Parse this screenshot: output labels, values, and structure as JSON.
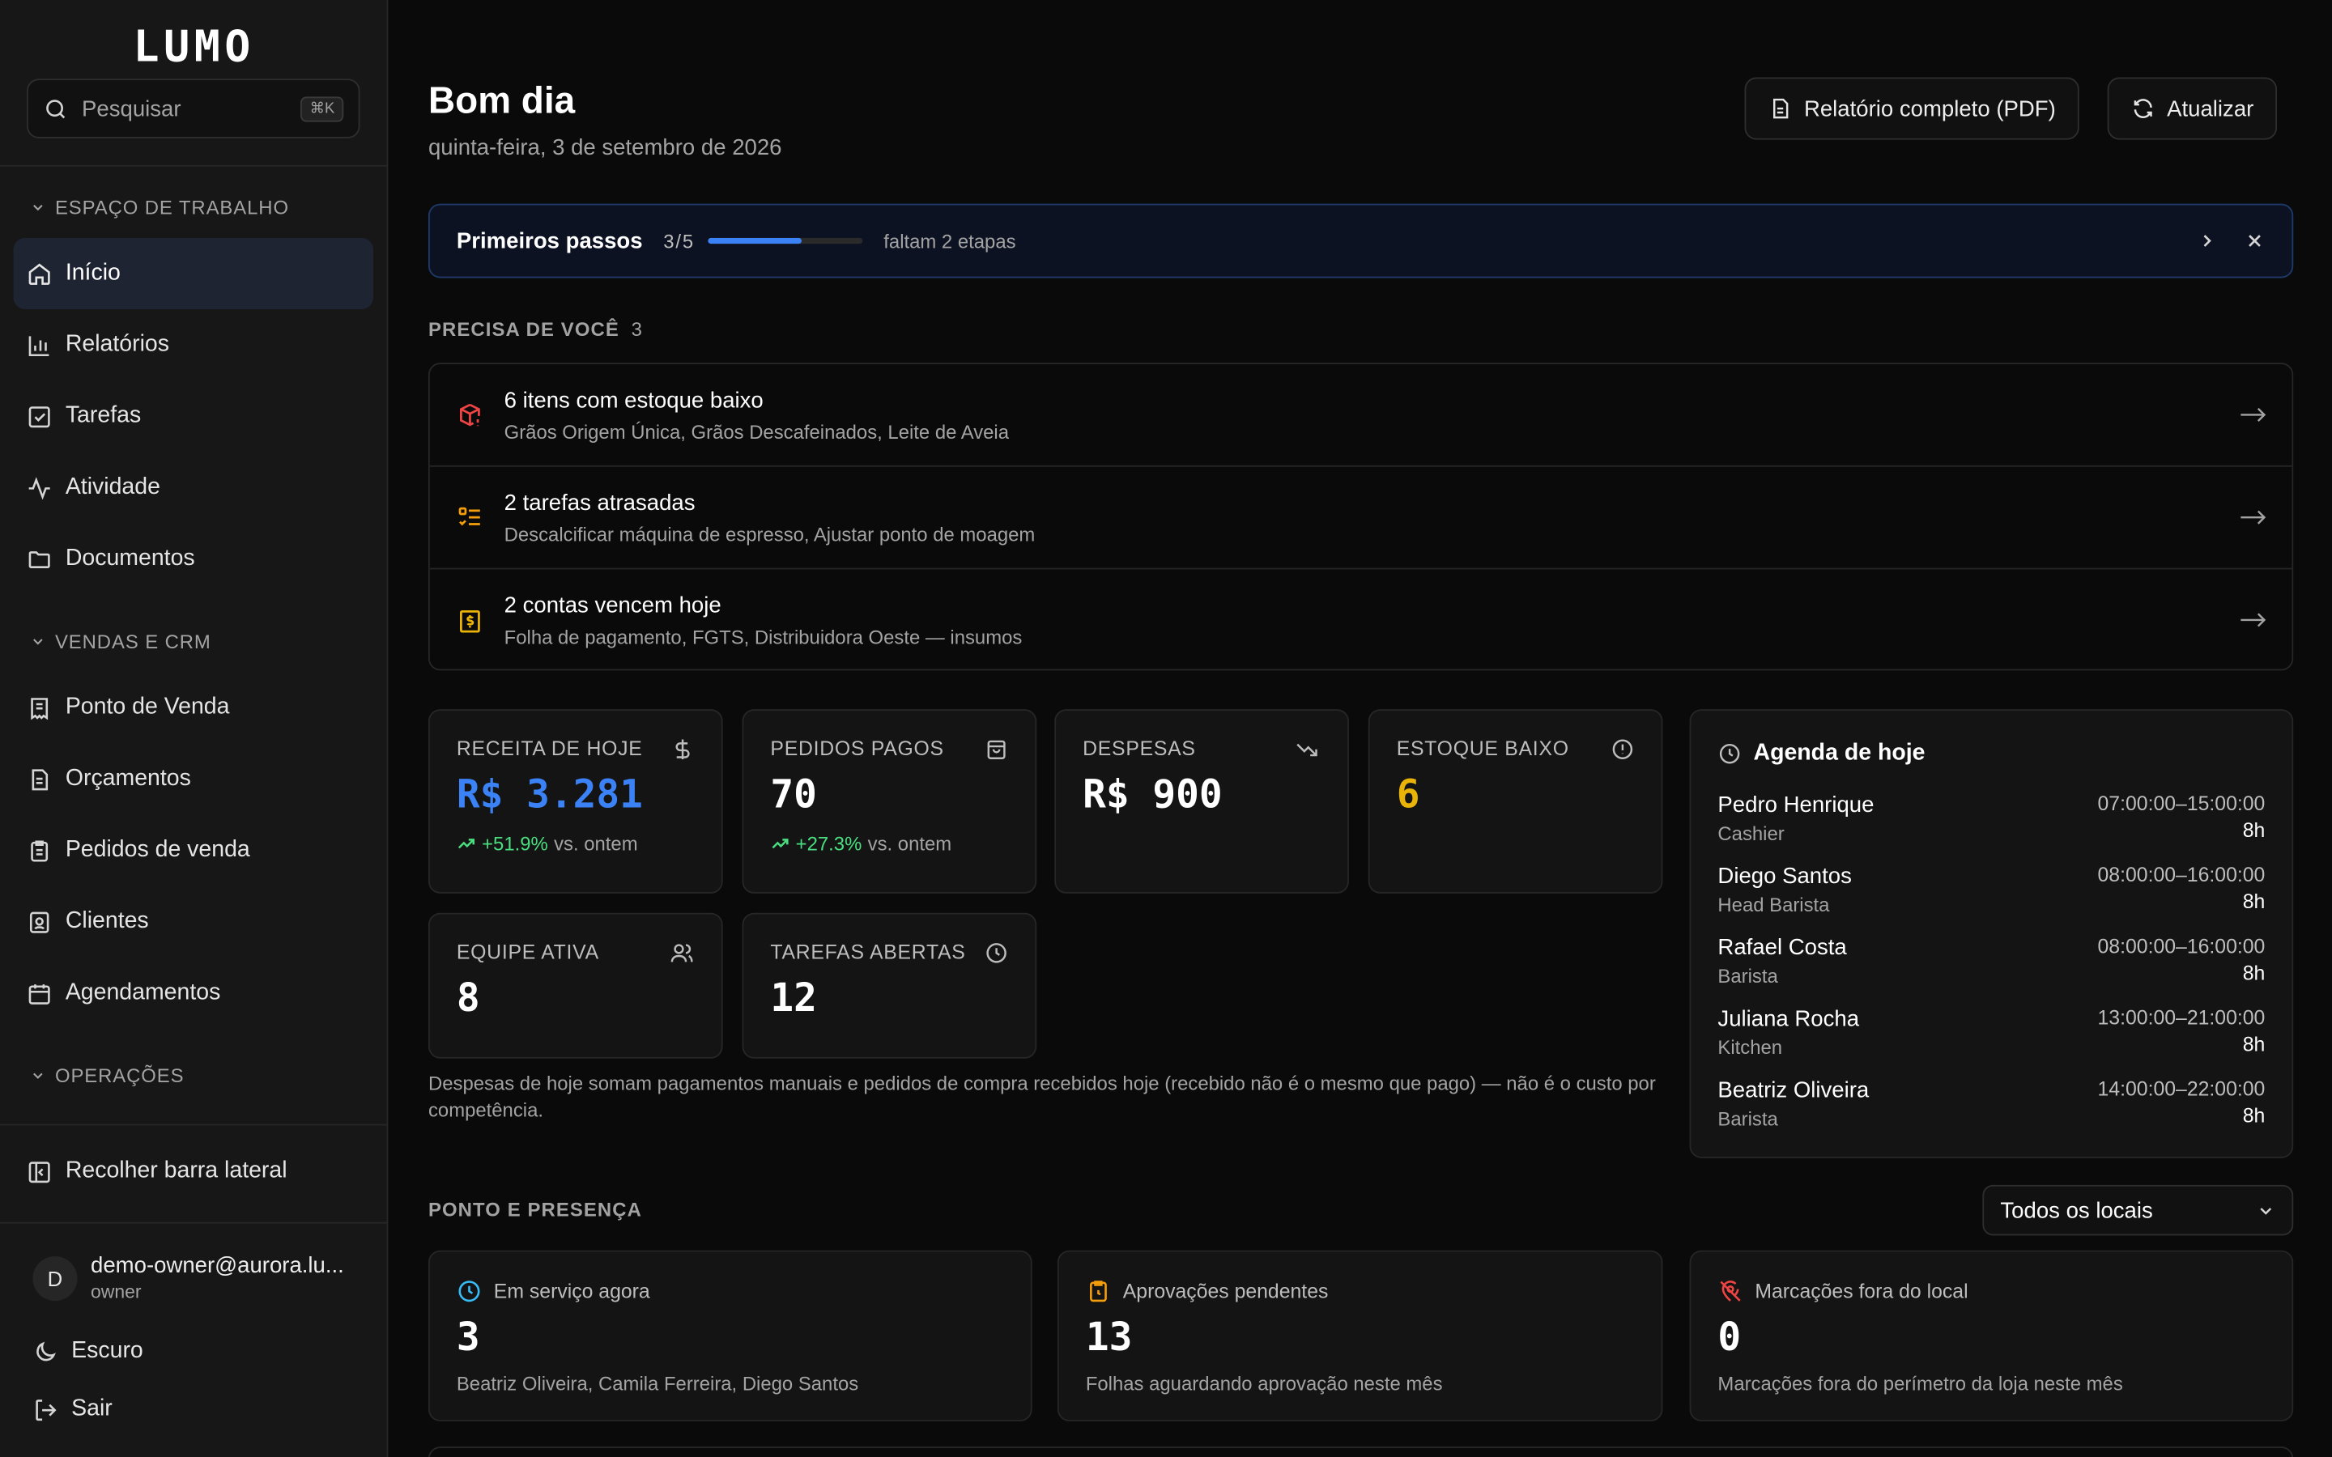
{
  "brand": {
    "logo": "LUMO"
  },
  "search": {
    "placeholder": "Pesquisar",
    "shortcut": "⌘K"
  },
  "sidebar": {
    "workspace_title": "ESPAÇO DE TRABALHO",
    "workspace": [
      {
        "label": "Início",
        "icon": "home-icon",
        "active": true
      },
      {
        "label": "Relatórios",
        "icon": "bar-chart-icon"
      },
      {
        "label": "Tarefas",
        "icon": "checkbox-icon"
      },
      {
        "label": "Atividade",
        "icon": "activity-icon"
      },
      {
        "label": "Documentos",
        "icon": "folder-icon"
      }
    ],
    "sales_title": "VENDAS E CRM",
    "sales": [
      {
        "label": "Ponto de Venda",
        "icon": "receipt-icon"
      },
      {
        "label": "Orçamentos",
        "icon": "document-icon"
      },
      {
        "label": "Pedidos de venda",
        "icon": "clipboard-icon"
      },
      {
        "label": "Clientes",
        "icon": "contact-icon"
      },
      {
        "label": "Agendamentos",
        "icon": "calendar-icon"
      }
    ],
    "ops_title": "OPERAÇÕES",
    "collapse": "Recolher barra lateral",
    "user": {
      "initial": "D",
      "email": "demo-owner@aurora.lu...",
      "role": "owner"
    },
    "theme": "Escuro",
    "logout": "Sair"
  },
  "header": {
    "greeting": "Bom dia",
    "date": "quinta-feira, 3 de setembro de 2026",
    "report_button": "Relatório completo (PDF)",
    "refresh_button": "Atualizar"
  },
  "onboarding": {
    "title": "Primeiros passos",
    "count": "3/5",
    "progress": 0.6,
    "remaining": "faltam 2 etapas"
  },
  "needs_you": {
    "title": "PRECISA DE VOCÊ",
    "count": "3",
    "items": [
      {
        "title": "6 itens com estoque baixo",
        "subtitle": "Grãos Origem Única, Grãos Descafeinados, Leite de Aveia",
        "icon": "package-alert-icon",
        "color": "#ef4444"
      },
      {
        "title": "2 tarefas atrasadas",
        "subtitle": "Descalcificar máquina de espresso, Ajustar ponto de moagem",
        "icon": "task-list-icon",
        "color": "#f59e0b"
      },
      {
        "title": "2 contas vencem hoje",
        "subtitle": "Folha de pagamento, FGTS, Distribuidora Oeste — insumos",
        "icon": "bill-icon",
        "color": "#eab308"
      }
    ]
  },
  "stats": {
    "revenue": {
      "label": "RECEITA DE HOJE",
      "value": "R$ 3.281",
      "delta": "+51.9%",
      "delta_suffix": "vs. ontem",
      "color": "#3b82f6"
    },
    "orders": {
      "label": "PEDIDOS PAGOS",
      "value": "70",
      "delta": "+27.3%",
      "delta_suffix": "vs. ontem"
    },
    "expenses": {
      "label": "DESPESAS",
      "value": "R$ 900"
    },
    "low_stock": {
      "label": "ESTOQUE BAIXO",
      "value": "6",
      "color": "#eab308"
    },
    "team": {
      "label": "EQUIPE ATIVA",
      "value": "8"
    },
    "open_tasks": {
      "label": "TAREFAS ABERTAS",
      "value": "12"
    },
    "note": "Despesas de hoje somam pagamentos manuais e pedidos de compra recebidos hoje (recebido não é o mesmo que pago) — não é o custo por competência."
  },
  "agenda": {
    "title": "Agenda de hoje",
    "shifts": [
      {
        "name": "Pedro Henrique",
        "role": "Cashier",
        "time": "07:00:00–15:00:00",
        "hours": "8h"
      },
      {
        "name": "Diego Santos",
        "role": "Head Barista",
        "time": "08:00:00–16:00:00",
        "hours": "8h"
      },
      {
        "name": "Rafael Costa",
        "role": "Barista",
        "time": "08:00:00–16:00:00",
        "hours": "8h"
      },
      {
        "name": "Juliana Rocha",
        "role": "Kitchen",
        "time": "13:00:00–21:00:00",
        "hours": "8h"
      },
      {
        "name": "Beatriz Oliveira",
        "role": "Barista",
        "time": "14:00:00–22:00:00",
        "hours": "8h"
      }
    ]
  },
  "attendance": {
    "title": "PONTO E PRESENÇA",
    "location_select": "Todos os locais",
    "cards": [
      {
        "label": "Em serviço agora",
        "value": "3",
        "subtitle": "Beatriz Oliveira, Camila Ferreira, Diego Santos",
        "icon": "clock-icon",
        "color": "#38bdf8"
      },
      {
        "label": "Aprovações pendentes",
        "value": "13",
        "subtitle": "Folhas aguardando aprovação neste mês",
        "icon": "clipboard-clock-icon",
        "color": "#f59e0b"
      },
      {
        "label": "Marcações fora do local",
        "value": "0",
        "subtitle": "Marcações fora do perímetro da loja neste mês",
        "icon": "map-pin-off-icon",
        "color": "#ef4444"
      }
    ]
  }
}
